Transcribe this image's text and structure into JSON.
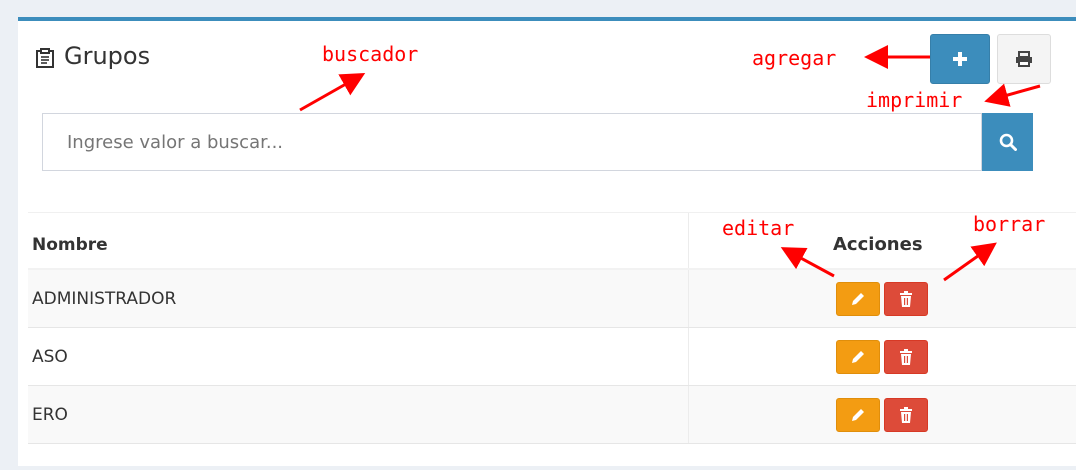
{
  "panel": {
    "title": "Grupos",
    "add_icon": "plus-icon",
    "print_icon": "print-icon",
    "title_icon": "clipboard-icon"
  },
  "search": {
    "placeholder": "Ingrese valor a buscar...",
    "value": "",
    "button_icon": "search-icon"
  },
  "table": {
    "columns": [
      "Nombre",
      "Acciones"
    ],
    "rows": [
      {
        "name": "ADMINISTRADOR"
      },
      {
        "name": "ASO"
      },
      {
        "name": "ERO"
      }
    ],
    "edit_icon": "pencil-icon",
    "delete_icon": "trash-icon"
  },
  "annotations": {
    "buscador": "buscador",
    "agregar": "agregar",
    "imprimir": "imprimir",
    "editar": "editar",
    "borrar": "borrar"
  },
  "colors": {
    "primary": "#3c8dbc",
    "warning": "#f39c12",
    "danger": "#dd4b39",
    "annotation": "#ff0000"
  }
}
